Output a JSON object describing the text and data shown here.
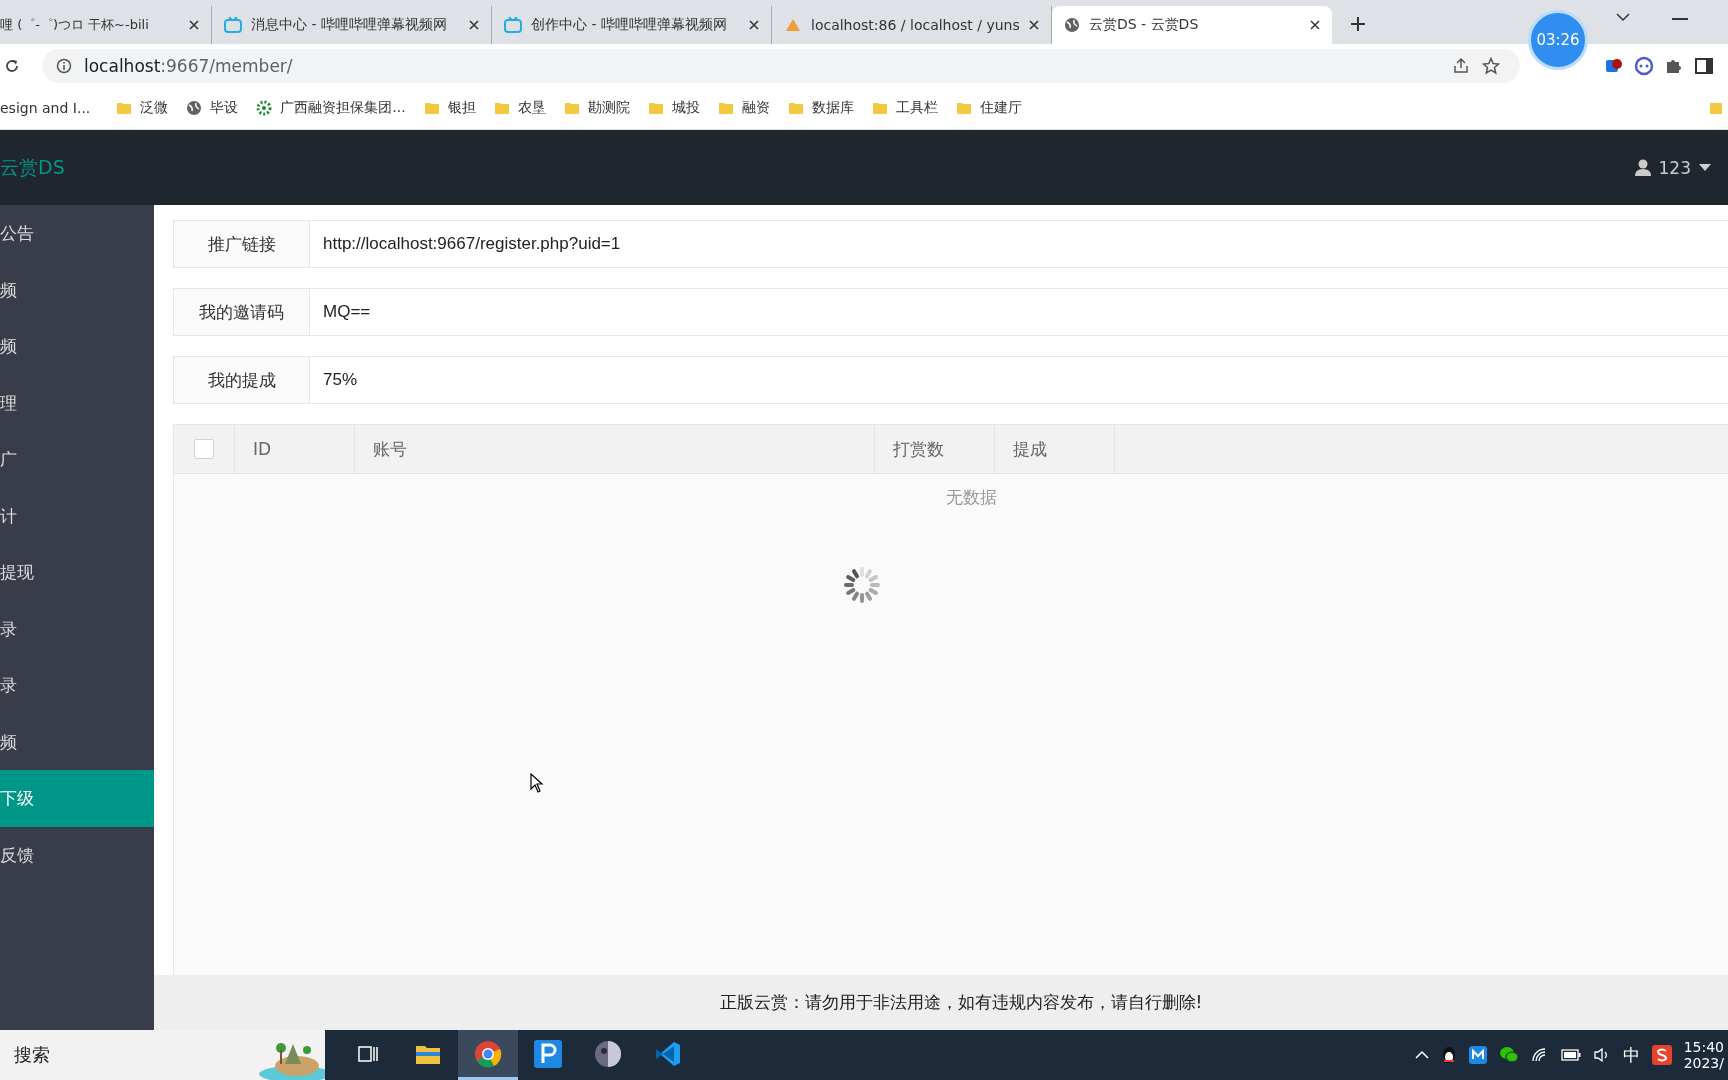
{
  "browser": {
    "tabs": [
      {
        "title": "哩 (゜-゜)つロ 干杯~-bili",
        "kind": "plain",
        "selected": false
      },
      {
        "title": "消息中心 - 哔哩哔哩弹幕视频网",
        "kind": "tv",
        "selected": false
      },
      {
        "title": "创作中心 - 哔哩哔哩弹幕视频网",
        "kind": "tv",
        "selected": false
      },
      {
        "title": "localhost:86 / localhost / yuns",
        "kind": "pma",
        "selected": false
      },
      {
        "title": "云赏DS - 云赏DS",
        "kind": "globe",
        "selected": true
      }
    ],
    "timer": "03:26",
    "address": {
      "host": "localhost",
      "rest": ":9667/member/"
    },
    "bookmarks": [
      {
        "label": "esign and I...",
        "kind": "plain"
      },
      {
        "label": "泛微",
        "kind": "folder"
      },
      {
        "label": "毕设",
        "kind": "globe"
      },
      {
        "label": "广西融资担保集团...",
        "kind": "gear"
      },
      {
        "label": "银担",
        "kind": "folder"
      },
      {
        "label": "农垦",
        "kind": "folder"
      },
      {
        "label": "勘测院",
        "kind": "folder"
      },
      {
        "label": "城投",
        "kind": "folder"
      },
      {
        "label": "融资",
        "kind": "folder"
      },
      {
        "label": "数据库",
        "kind": "folder"
      },
      {
        "label": "工具栏",
        "kind": "folder"
      },
      {
        "label": "住建厅",
        "kind": "folder"
      }
    ]
  },
  "header": {
    "logo": "云赏DS",
    "user": "123"
  },
  "sidebar": {
    "items": [
      {
        "label": "公告",
        "selected": false
      },
      {
        "label": "频",
        "selected": false
      },
      {
        "label": "频",
        "selected": false
      },
      {
        "label": "理",
        "selected": false
      },
      {
        "label": "广",
        "selected": false
      },
      {
        "label": "计",
        "selected": false
      },
      {
        "label": "提现",
        "selected": false
      },
      {
        "label": "录",
        "selected": false
      },
      {
        "label": "录",
        "selected": false
      },
      {
        "label": "频",
        "selected": false
      },
      {
        "label": "下级",
        "selected": true
      },
      {
        "label": "反馈",
        "selected": false
      }
    ]
  },
  "fields": [
    {
      "label": "推广链接",
      "value": "http://localhost:9667/register.php?uid=1"
    },
    {
      "label": "我的邀请码",
      "value": "MQ=="
    },
    {
      "label": "我的提成",
      "value": "75%"
    }
  ],
  "table": {
    "all_checked": false,
    "columns": [
      "ID",
      "账号",
      "打赏数",
      "提成"
    ],
    "empty_text": "无数据",
    "loading": true
  },
  "footer": "正版云赏：请勿用于非法用途，如有违规内容发布，请自行删除!",
  "taskbar": {
    "search": "搜索",
    "apps": [
      {
        "kind": "taskview",
        "selected": false
      },
      {
        "kind": "folder",
        "selected": false
      },
      {
        "kind": "chrome",
        "selected": true
      },
      {
        "kind": "p",
        "selected": false
      },
      {
        "kind": "orb",
        "selected": false
      },
      {
        "kind": "code",
        "selected": false
      }
    ],
    "tray_ime": "中",
    "time": "15:40",
    "date": "2023/"
  }
}
